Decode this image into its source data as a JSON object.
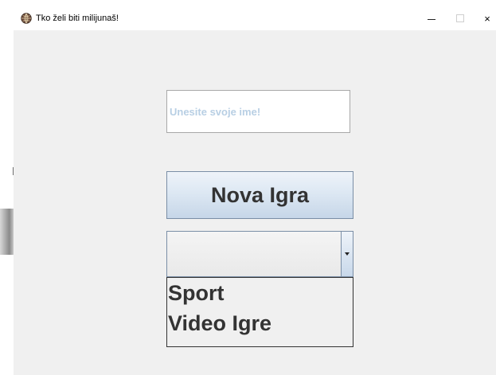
{
  "window": {
    "title": "Tko želi biti milijunaš!",
    "icon": "globe-icon",
    "controls": {
      "minimize": "minimize-icon",
      "maximize": "maximize-icon",
      "close": "×"
    }
  },
  "name_input": {
    "placeholder": "Unesite svoje ime!",
    "value": ""
  },
  "new_game_button": {
    "label": "Nova Igra"
  },
  "category_combo": {
    "selected": "",
    "options": [
      "Sport",
      "Video Igre"
    ]
  },
  "colors": {
    "window_bg": "#f0f0f0",
    "button_gradient_top": "#eef3f9",
    "button_gradient_bottom": "#c6d6e8",
    "placeholder": "#b8cfe4",
    "text": "#333333"
  }
}
